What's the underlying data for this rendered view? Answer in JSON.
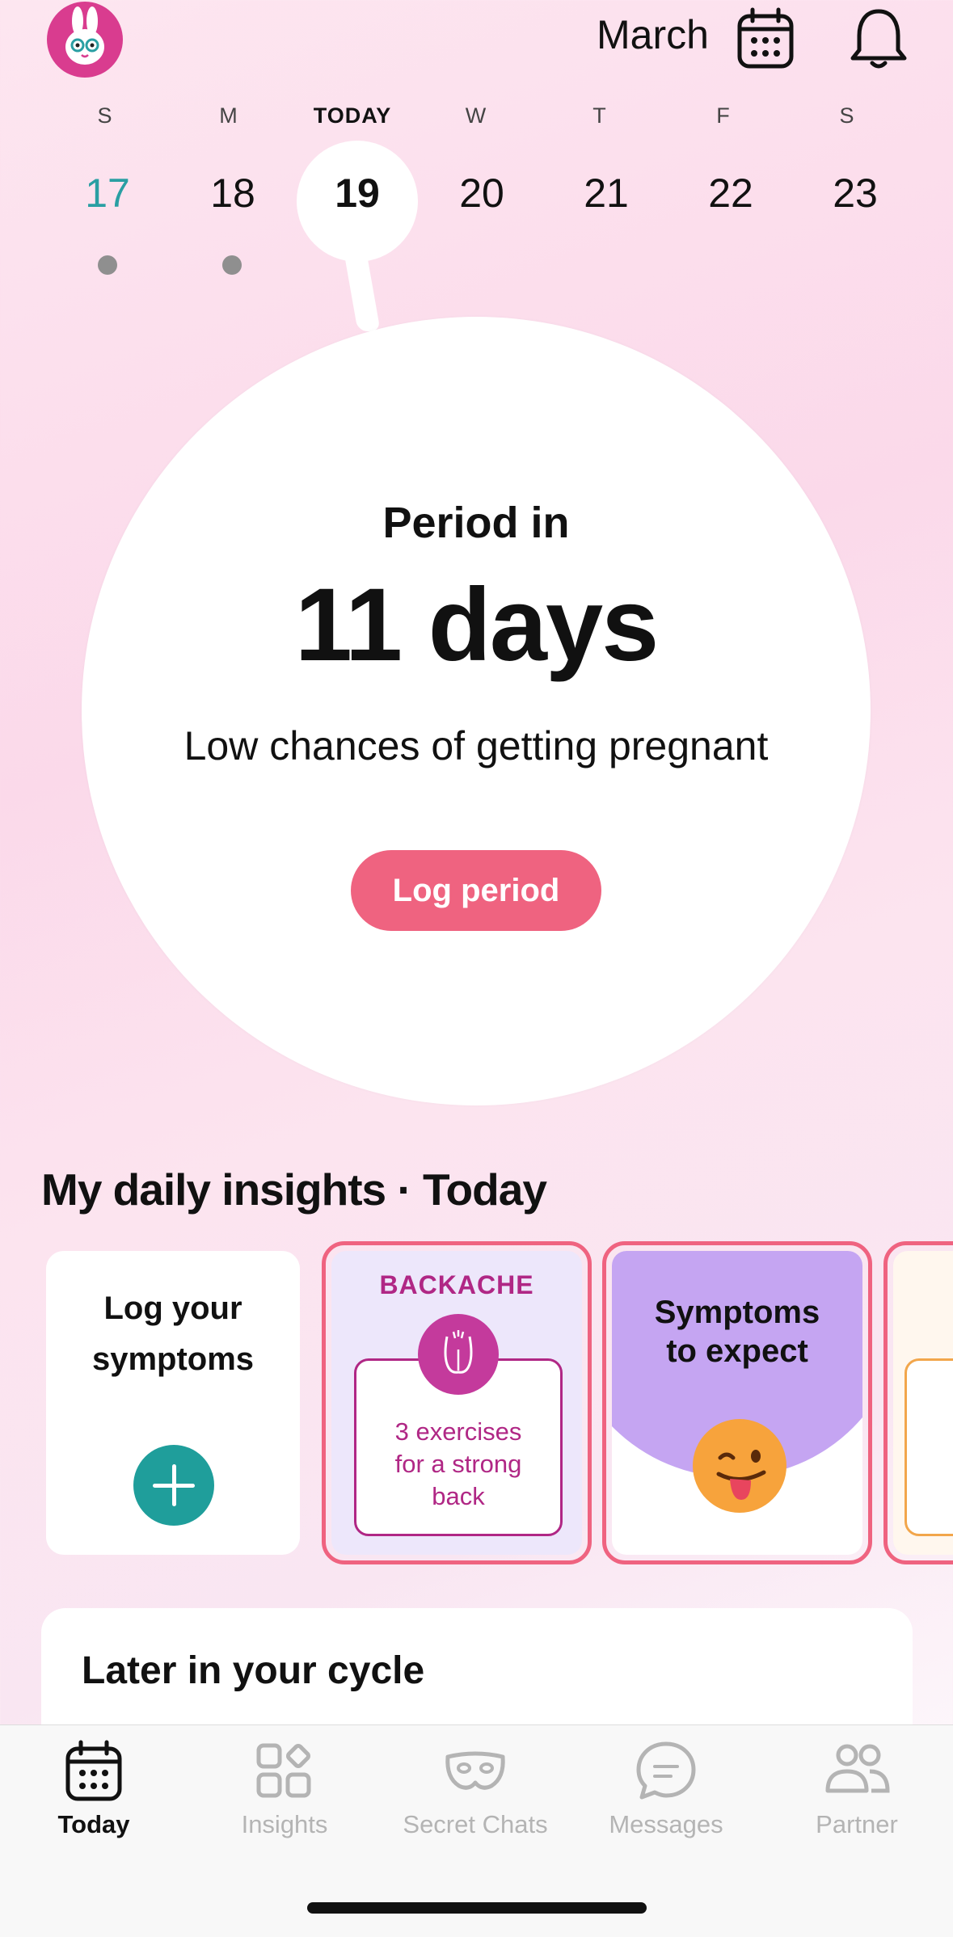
{
  "header": {
    "month": "March"
  },
  "week": {
    "days": [
      {
        "dow": "S",
        "num": "17"
      },
      {
        "dow": "M",
        "num": "18"
      },
      {
        "dow": "TODAY",
        "num": "19"
      },
      {
        "dow": "W",
        "num": "20"
      },
      {
        "dow": "T",
        "num": "21"
      },
      {
        "dow": "F",
        "num": "22"
      },
      {
        "dow": "S",
        "num": "23"
      }
    ]
  },
  "cycle": {
    "period_in": "Period in",
    "days_count": "11 days",
    "chances": "Low chances of getting pregnant",
    "log_period": "Log period"
  },
  "insights": {
    "title": "My daily insights · Today",
    "log_card": "Log your symptoms",
    "backache": {
      "title": "BACKACHE",
      "text": "3 exercises for a strong back"
    },
    "symptoms": {
      "text": "Symptoms to expect"
    }
  },
  "later": {
    "title": "Later in your cycle"
  },
  "tabs": [
    {
      "label": "Today"
    },
    {
      "label": "Insights"
    },
    {
      "label": "Secret Chats"
    },
    {
      "label": "Messages"
    },
    {
      "label": "Partner"
    }
  ],
  "colors": {
    "accent": "#ef6380",
    "teal": "#1f9e9b",
    "purple": "#b02785",
    "lavender": "#c5a5f2"
  }
}
